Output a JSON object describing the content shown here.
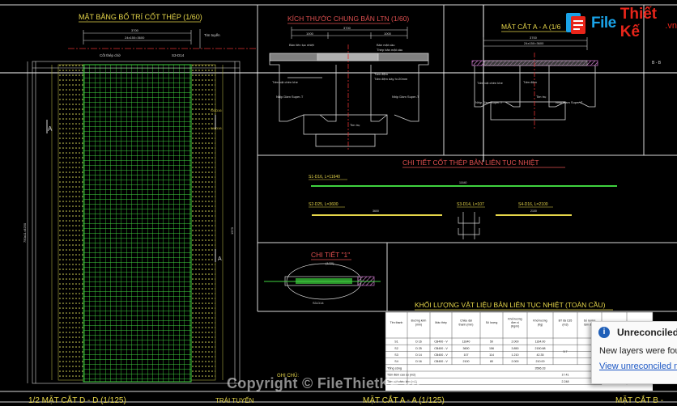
{
  "drawing": {
    "plan_title": "MẶT BẰNG BỐ TRÍ CỐT THÉP (1/60)",
    "general_title": "KÍCH THƯỚC CHUNG BẢN LTN (1/60)",
    "section_aa_title": "MẶT CẮT A - A (1/6",
    "rebar_detail_title": "CHI TIẾT CỐT THÉP BẢN LIÊN TỤC NHIỆT",
    "detail1_title": "CHI TIẾT \"1\"",
    "detail1_scale": "(1/20)",
    "material_title": "KHỐI LƯỢNG VẬT LIỆU BẢN LIÊN TỤC NHIỆT (TOÀN CẦU)",
    "notes_label": "GHI CHÚ:",
    "bottom_left_title": "1/2 MẶT CẮT D - D (1/125)",
    "bottom_mid_label": "TRÁI TUYẾN",
    "bottom_center_title": "MẶT CẮT A - A (1/125)",
    "bottom_right_title": "MẶT CẮT B -",
    "right_sep_label": "B - B",
    "marker_a": "A",
    "bar_s1": "S1-D16, L=11640",
    "bar_s2": "S2-D25, L=3600",
    "bar_s3": "S3-D14, L=107",
    "bar_s4": "S4-D16, L=2100",
    "bar_s1_len": "11640",
    "bar_s2_len": "3600",
    "bar_s4_len": "2100",
    "dim_3700": "3700",
    "dim_span": "24x150=3600",
    "dim_1000": "1000",
    "lbl_tim_tuyen": "Tim tuyến",
    "lbl_cot_thep_chi": "Cốt thép chờ",
    "lbl_s3_d14": "S3-D14",
    "lbl_ban_lien_tuc": "Bản liên tục nhiệt",
    "lbl_dam_super_t": "Nhịp Dầm Super-T",
    "lbl_tam_dem": "Tấm đệm",
    "lbl_tim_tru": "Tim trụ",
    "lbl_section_bot": "Bản mặt cầu",
    "lbl_thep_ban": "Thép bản mặt cầu",
    "lbl_tam_vat": "Tấm vật chèn khe",
    "lbl_day_dem": "Tấm đệm dày h=20mm",
    "lbl_dim_left": "750x11=8250",
    "lbl_dim_right": "1973",
    "lbl_d_left": "S4-D16",
    "lbl_d_right": "S4-D16"
  },
  "table": {
    "headers": [
      "Tên thanh",
      "Đường kính (mm)",
      "Mác thép",
      "Chiều dài thanh (mm)",
      "Số lượng",
      "Khối lượng đơn vị (Kg/m)",
      "Khối lượng (Kg)",
      "BT đá C35 (m3)",
      "Số lượng tấm đệm",
      "Bê tông"
    ],
    "rows": [
      [
        "S1",
        "D 16",
        "CB400 - V",
        "11640",
        "50",
        "2.000",
        "1164.00",
        "",
        "",
        ""
      ],
      [
        "S2",
        "D 25",
        "CB400 - V",
        "3600",
        "156",
        "3.850",
        "2150.88",
        "",
        "",
        ""
      ],
      [
        "S3",
        "D 14",
        "CB400 - V",
        "107",
        "114",
        "1.210",
        "42.35",
        "",
        "",
        ""
      ],
      [
        "S4",
        "D 16",
        "CB400 - V",
        "2100",
        "80",
        "2.000",
        "210.00",
        "",
        "",
        ""
      ]
    ],
    "merged_value": "5.7",
    "total_label": "Tổng cộng",
    "total_value": "3566.33",
    "extra_rows": [
      [
        "Tấm đệm cao su (m2)",
        "17.41"
      ],
      [
        "Tấm vật chèn khe (m2)",
        "2.248"
      ]
    ]
  },
  "notification": {
    "title": "Unreconciled New Layers",
    "message": "New layers were found",
    "link": "View unreconciled new layers"
  },
  "watermark": "Copyright © FileThietKe.vn",
  "logo": {
    "text1": "File",
    "text2": "Thiết Kế",
    "text3": ".vn"
  }
}
